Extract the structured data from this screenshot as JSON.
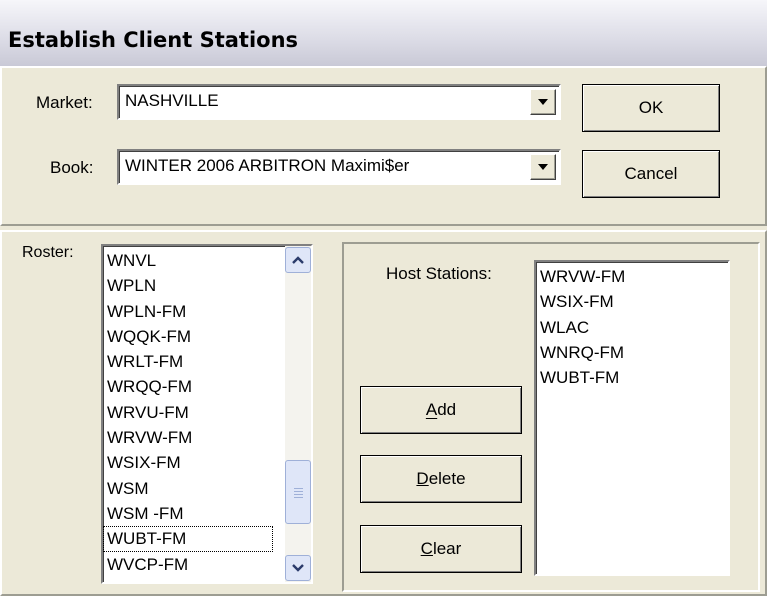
{
  "window": {
    "title": "Establish Client Stations"
  },
  "market": {
    "label": "Market:",
    "value": "NASHVILLE"
  },
  "book": {
    "label": "Book:",
    "value": "WINTER 2006 ARBITRON Maximi$er"
  },
  "buttons": {
    "ok": "OK",
    "cancel": "Cancel",
    "add": "Add",
    "delete": "Delete",
    "clear": "Clear"
  },
  "roster": {
    "label": "Roster:",
    "items": [
      "WNVL",
      "WPLN",
      "WPLN-FM",
      "WQQK-FM",
      "WRLT-FM",
      "WRQQ-FM",
      "WRVU-FM",
      "WRVW-FM",
      "WSIX-FM",
      "WSM",
      "WSM -FM",
      "WUBT-FM",
      "WVCP-FM"
    ],
    "focused": "WUBT-FM"
  },
  "host": {
    "label": "Host Stations:",
    "items": [
      "WRVW-FM",
      "WSIX-FM",
      "WLAC",
      "WNRQ-FM",
      "WUBT-FM"
    ]
  },
  "icons": {
    "dropdown": "chevron-down-icon",
    "scroll_up": "scroll-up-arrow-icon",
    "scroll_down": "scroll-down-arrow-icon"
  }
}
